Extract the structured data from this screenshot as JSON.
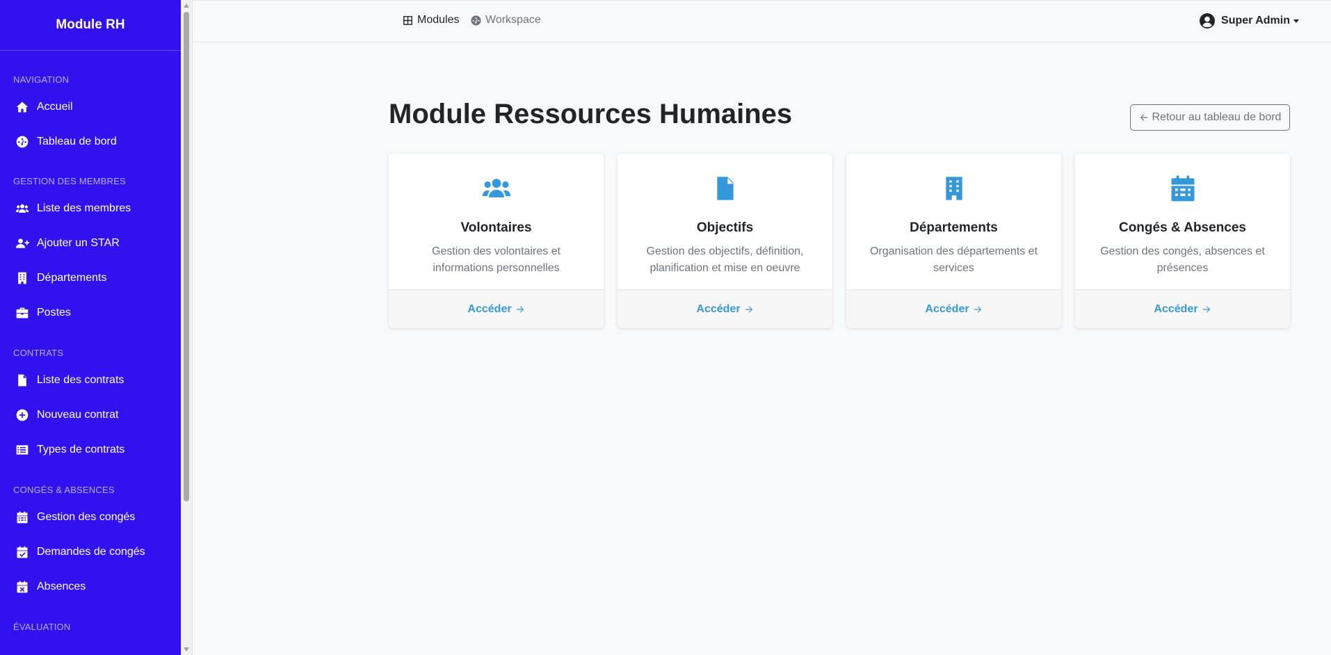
{
  "sidebar": {
    "brand": "Module RH",
    "sections": [
      {
        "title": "NAVIGATION",
        "items": [
          {
            "label": "Accueil",
            "icon": "home-icon"
          },
          {
            "label": "Tableau de bord",
            "icon": "gauge-icon"
          }
        ]
      },
      {
        "title": "GESTION DES MEMBRES",
        "items": [
          {
            "label": "Liste des membres",
            "icon": "users-icon"
          },
          {
            "label": "Ajouter un STAR",
            "icon": "user-plus-icon"
          },
          {
            "label": "Départements",
            "icon": "building-icon"
          },
          {
            "label": "Postes",
            "icon": "briefcase-icon"
          }
        ]
      },
      {
        "title": "CONTRATS",
        "items": [
          {
            "label": "Liste des contrats",
            "icon": "file-contract-icon"
          },
          {
            "label": "Nouveau contrat",
            "icon": "plus-circle-icon"
          },
          {
            "label": "Types de contrats",
            "icon": "list-icon"
          }
        ]
      },
      {
        "title": "CONGÉS & ABSENCES",
        "items": [
          {
            "label": "Gestion des congés",
            "icon": "calendar-icon"
          },
          {
            "label": "Demandes de congés",
            "icon": "calendar-check-icon"
          },
          {
            "label": "Absences",
            "icon": "calendar-x-icon"
          }
        ]
      },
      {
        "title": "ÉVALUATION",
        "items": []
      }
    ]
  },
  "topbar": {
    "modules_label": "Modules",
    "workspace_label": "Workspace",
    "user_label": "Super Admin"
  },
  "main": {
    "title": "Module Ressources Humaines",
    "back_label": "Retour au tableau de bord",
    "cards": [
      {
        "title": "Volontaires",
        "description": "Gestion des volontaires et informations personnelles",
        "link": "Accéder",
        "icon": "users-icon"
      },
      {
        "title": "Objectifs",
        "description": "Gestion des objectifs, définition, planification et mise en oeuvre",
        "link": "Accéder",
        "icon": "file-contract-icon"
      },
      {
        "title": "Départements",
        "description": "Organisation des départements et services",
        "link": "Accéder",
        "icon": "building-icon"
      },
      {
        "title": "Congés & Absences",
        "description": "Gestion des congés, absences et présences",
        "link": "Accéder",
        "icon": "calendar-icon"
      }
    ]
  },
  "colors": {
    "sidebar_bg": "#3311ee",
    "accent": "#3498db",
    "page_bg": "#f8f9fa"
  }
}
